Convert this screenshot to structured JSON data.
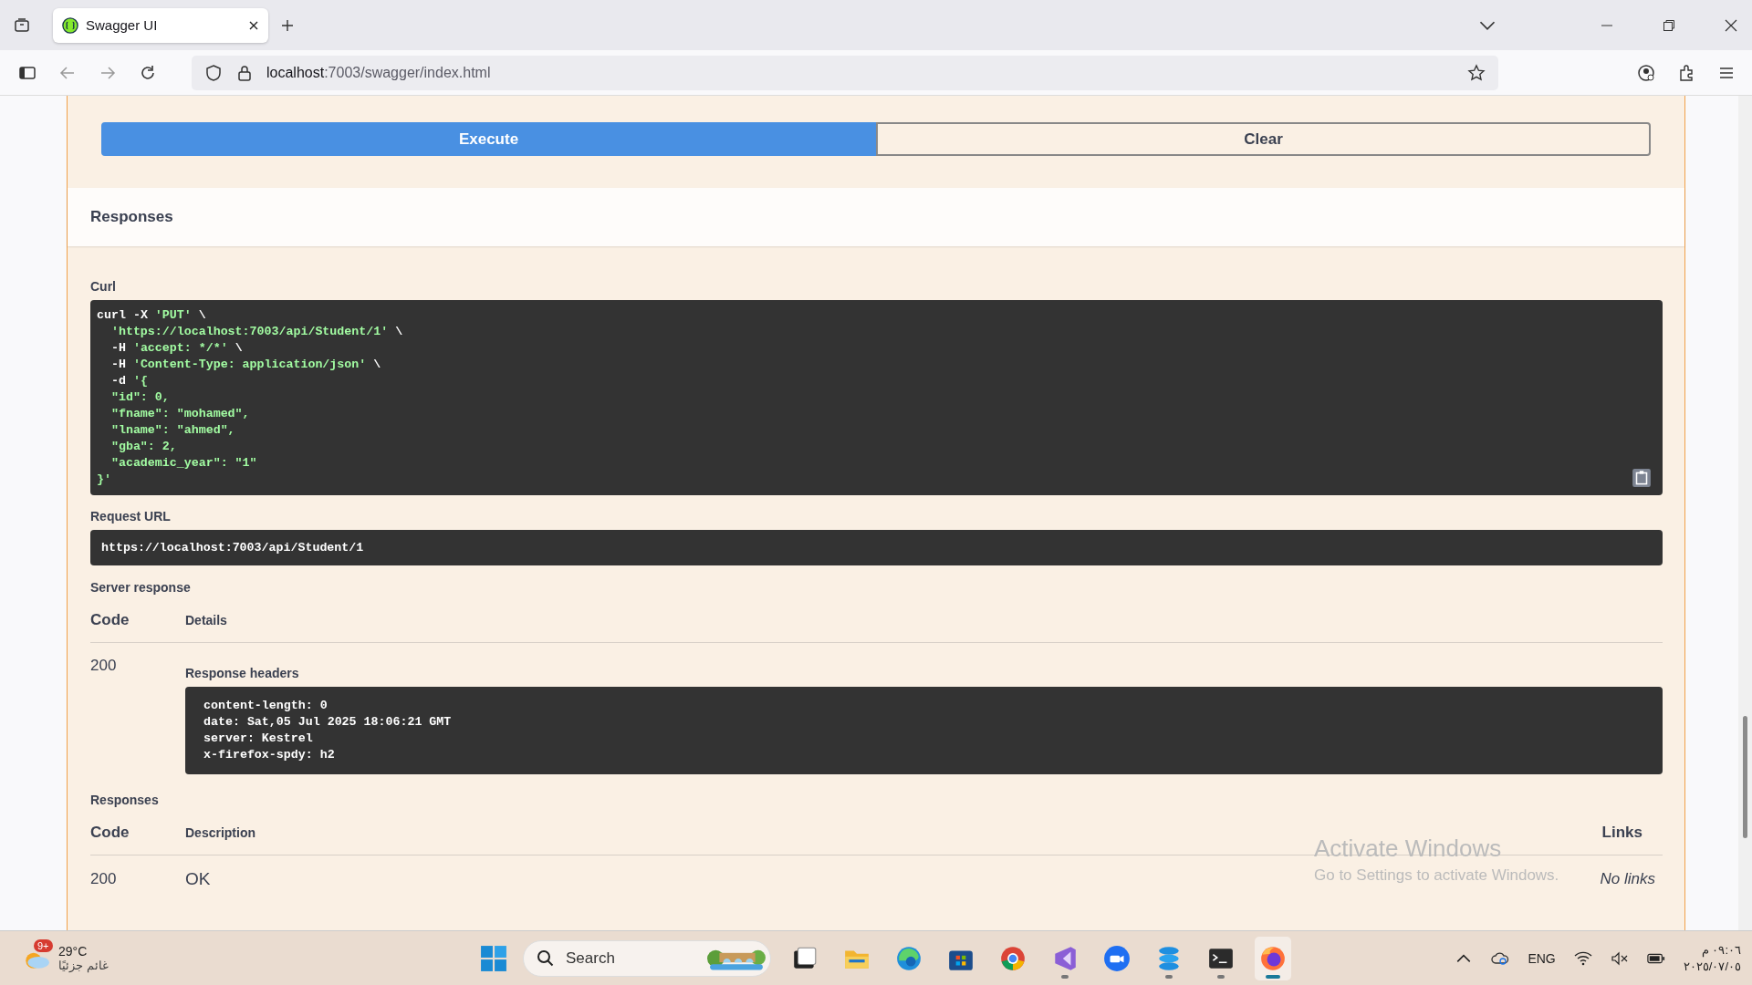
{
  "browser": {
    "tab": {
      "title": "Swagger UI",
      "selected": true
    },
    "url": {
      "host": "localhost",
      "path": ":7003/swagger/index.html"
    }
  },
  "actions": {
    "execute": "Execute",
    "clear": "Clear"
  },
  "responses_title": "Responses",
  "curl": {
    "label": "Curl",
    "lines": [
      {
        "indent": false,
        "parts": [
          {
            "code": "curl -X"
          },
          {
            "literal": "'PUT'"
          },
          {
            "code": "\\"
          }
        ]
      },
      {
        "indent": true,
        "parts": [
          {
            "literal": "'https://localhost:7003/api/Student/1'"
          },
          {
            "code": "\\"
          }
        ]
      },
      {
        "indent": true,
        "parts": [
          {
            "code": "-H"
          },
          {
            "literal": "'accept: */*'"
          },
          {
            "code": "\\"
          }
        ]
      },
      {
        "indent": true,
        "parts": [
          {
            "code": "-H"
          },
          {
            "literal": "'Content-Type: application/json'"
          },
          {
            "code": "\\"
          }
        ]
      },
      {
        "indent": true,
        "parts": [
          {
            "code": "-d"
          },
          {
            "literal": "'{"
          }
        ]
      },
      {
        "indent": true,
        "parts": [
          {
            "literal": "\"id\": 0,"
          }
        ]
      },
      {
        "indent": true,
        "parts": [
          {
            "literal": "\"fname\": \"mohamed\","
          }
        ]
      },
      {
        "indent": true,
        "parts": [
          {
            "literal": "\"lname\": \"ahmed\","
          }
        ]
      },
      {
        "indent": true,
        "parts": [
          {
            "literal": "\"gba\": 2,"
          }
        ]
      },
      {
        "indent": true,
        "parts": [
          {
            "literal": "\"academic_year\": \"1\""
          }
        ]
      },
      {
        "indent": false,
        "parts": [
          {
            "literal": "}'"
          }
        ]
      }
    ]
  },
  "request_url": {
    "label": "Request URL",
    "value": "https://localhost:7003/api/Student/1"
  },
  "server_response": {
    "label": "Server response",
    "columns": [
      "Code",
      "Details"
    ],
    "code": "200",
    "headers_label": "Response headers",
    "headers": [
      "content-length: 0",
      "date: Sat,05 Jul 2025 18:06:21 GMT",
      "server: Kestrel",
      "x-firefox-spdy: h2"
    ]
  },
  "responses": {
    "label": "Responses",
    "columns": [
      "Code",
      "Description",
      "Links"
    ],
    "rows": [
      {
        "code": "200",
        "description": "OK",
        "links": "No links"
      }
    ]
  },
  "activation": {
    "title": "Activate Windows",
    "text": "Go to Settings to activate Windows."
  },
  "taskbar": {
    "weather": {
      "badge": "9+",
      "temp": "29°C",
      "text": "غائم جزئيًا"
    },
    "search": "Search",
    "apps": [
      {
        "kind": "tasks",
        "running": false,
        "selected": false
      },
      {
        "kind": "files",
        "running": false,
        "selected": false
      },
      {
        "kind": "edge",
        "running": false,
        "selected": false
      },
      {
        "kind": "store",
        "running": false,
        "selected": false
      },
      {
        "kind": "chrome",
        "running": false,
        "selected": false
      },
      {
        "kind": "vs",
        "running": true,
        "selected": false
      },
      {
        "kind": "zoom",
        "running": false,
        "selected": false
      },
      {
        "kind": "stack",
        "running": true,
        "selected": false
      },
      {
        "kind": "terminal",
        "running": true,
        "selected": false
      },
      {
        "kind": "firefox",
        "running": true,
        "selected": true
      }
    ],
    "lang": "ENG",
    "time": "٠٩:٠٦ م",
    "date": "٢٠٢٥/٠٧/٠٥"
  }
}
